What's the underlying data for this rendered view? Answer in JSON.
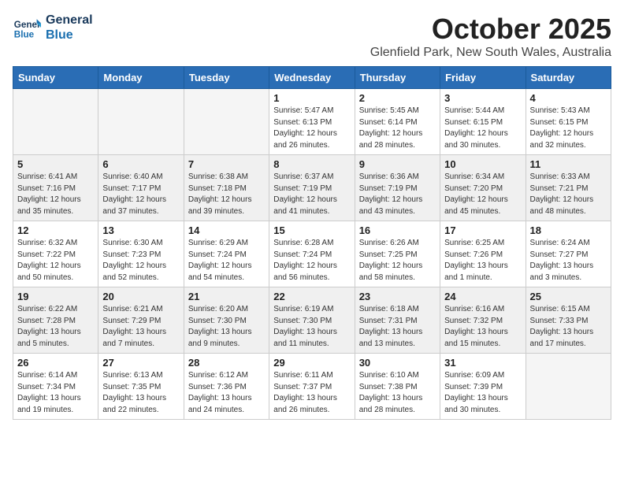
{
  "logo": {
    "line1": "General",
    "line2": "Blue"
  },
  "title": "October 2025",
  "location": "Glenfield Park, New South Wales, Australia",
  "headers": [
    "Sunday",
    "Monday",
    "Tuesday",
    "Wednesday",
    "Thursday",
    "Friday",
    "Saturday"
  ],
  "weeks": [
    {
      "shaded": false,
      "days": [
        {
          "num": "",
          "info": ""
        },
        {
          "num": "",
          "info": ""
        },
        {
          "num": "",
          "info": ""
        },
        {
          "num": "1",
          "info": "Sunrise: 5:47 AM\nSunset: 6:13 PM\nDaylight: 12 hours\nand 26 minutes."
        },
        {
          "num": "2",
          "info": "Sunrise: 5:45 AM\nSunset: 6:14 PM\nDaylight: 12 hours\nand 28 minutes."
        },
        {
          "num": "3",
          "info": "Sunrise: 5:44 AM\nSunset: 6:15 PM\nDaylight: 12 hours\nand 30 minutes."
        },
        {
          "num": "4",
          "info": "Sunrise: 5:43 AM\nSunset: 6:15 PM\nDaylight: 12 hours\nand 32 minutes."
        }
      ]
    },
    {
      "shaded": true,
      "days": [
        {
          "num": "5",
          "info": "Sunrise: 6:41 AM\nSunset: 7:16 PM\nDaylight: 12 hours\nand 35 minutes."
        },
        {
          "num": "6",
          "info": "Sunrise: 6:40 AM\nSunset: 7:17 PM\nDaylight: 12 hours\nand 37 minutes."
        },
        {
          "num": "7",
          "info": "Sunrise: 6:38 AM\nSunset: 7:18 PM\nDaylight: 12 hours\nand 39 minutes."
        },
        {
          "num": "8",
          "info": "Sunrise: 6:37 AM\nSunset: 7:19 PM\nDaylight: 12 hours\nand 41 minutes."
        },
        {
          "num": "9",
          "info": "Sunrise: 6:36 AM\nSunset: 7:19 PM\nDaylight: 12 hours\nand 43 minutes."
        },
        {
          "num": "10",
          "info": "Sunrise: 6:34 AM\nSunset: 7:20 PM\nDaylight: 12 hours\nand 45 minutes."
        },
        {
          "num": "11",
          "info": "Sunrise: 6:33 AM\nSunset: 7:21 PM\nDaylight: 12 hours\nand 48 minutes."
        }
      ]
    },
    {
      "shaded": false,
      "days": [
        {
          "num": "12",
          "info": "Sunrise: 6:32 AM\nSunset: 7:22 PM\nDaylight: 12 hours\nand 50 minutes."
        },
        {
          "num": "13",
          "info": "Sunrise: 6:30 AM\nSunset: 7:23 PM\nDaylight: 12 hours\nand 52 minutes."
        },
        {
          "num": "14",
          "info": "Sunrise: 6:29 AM\nSunset: 7:24 PM\nDaylight: 12 hours\nand 54 minutes."
        },
        {
          "num": "15",
          "info": "Sunrise: 6:28 AM\nSunset: 7:24 PM\nDaylight: 12 hours\nand 56 minutes."
        },
        {
          "num": "16",
          "info": "Sunrise: 6:26 AM\nSunset: 7:25 PM\nDaylight: 12 hours\nand 58 minutes."
        },
        {
          "num": "17",
          "info": "Sunrise: 6:25 AM\nSunset: 7:26 PM\nDaylight: 13 hours\nand 1 minute."
        },
        {
          "num": "18",
          "info": "Sunrise: 6:24 AM\nSunset: 7:27 PM\nDaylight: 13 hours\nand 3 minutes."
        }
      ]
    },
    {
      "shaded": true,
      "days": [
        {
          "num": "19",
          "info": "Sunrise: 6:22 AM\nSunset: 7:28 PM\nDaylight: 13 hours\nand 5 minutes."
        },
        {
          "num": "20",
          "info": "Sunrise: 6:21 AM\nSunset: 7:29 PM\nDaylight: 13 hours\nand 7 minutes."
        },
        {
          "num": "21",
          "info": "Sunrise: 6:20 AM\nSunset: 7:30 PM\nDaylight: 13 hours\nand 9 minutes."
        },
        {
          "num": "22",
          "info": "Sunrise: 6:19 AM\nSunset: 7:30 PM\nDaylight: 13 hours\nand 11 minutes."
        },
        {
          "num": "23",
          "info": "Sunrise: 6:18 AM\nSunset: 7:31 PM\nDaylight: 13 hours\nand 13 minutes."
        },
        {
          "num": "24",
          "info": "Sunrise: 6:16 AM\nSunset: 7:32 PM\nDaylight: 13 hours\nand 15 minutes."
        },
        {
          "num": "25",
          "info": "Sunrise: 6:15 AM\nSunset: 7:33 PM\nDaylight: 13 hours\nand 17 minutes."
        }
      ]
    },
    {
      "shaded": false,
      "days": [
        {
          "num": "26",
          "info": "Sunrise: 6:14 AM\nSunset: 7:34 PM\nDaylight: 13 hours\nand 19 minutes."
        },
        {
          "num": "27",
          "info": "Sunrise: 6:13 AM\nSunset: 7:35 PM\nDaylight: 13 hours\nand 22 minutes."
        },
        {
          "num": "28",
          "info": "Sunrise: 6:12 AM\nSunset: 7:36 PM\nDaylight: 13 hours\nand 24 minutes."
        },
        {
          "num": "29",
          "info": "Sunrise: 6:11 AM\nSunset: 7:37 PM\nDaylight: 13 hours\nand 26 minutes."
        },
        {
          "num": "30",
          "info": "Sunrise: 6:10 AM\nSunset: 7:38 PM\nDaylight: 13 hours\nand 28 minutes."
        },
        {
          "num": "31",
          "info": "Sunrise: 6:09 AM\nSunset: 7:39 PM\nDaylight: 13 hours\nand 30 minutes."
        },
        {
          "num": "",
          "info": ""
        }
      ]
    }
  ]
}
